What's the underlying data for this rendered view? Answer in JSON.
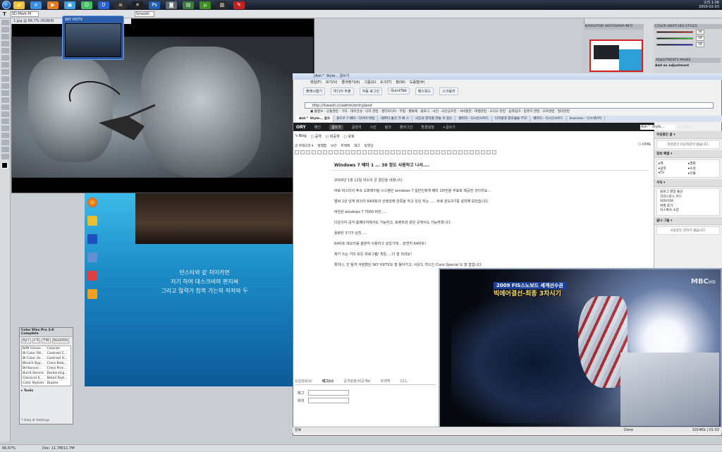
{
  "taskbar": {
    "clock_time": "오전 1:06",
    "clock_date": "2009-02-03",
    "buttons": [
      {
        "name": "explorer",
        "color": "#f0c040",
        "glyph": "📁"
      },
      {
        "name": "ie",
        "color": "#3a8de0",
        "glyph": "e"
      },
      {
        "name": "media",
        "color": "#e87a20",
        "glyph": "▶"
      },
      {
        "name": "paint",
        "color": "#40a0e0",
        "glyph": "▣"
      },
      {
        "name": "messenger",
        "color": "#40c060",
        "glyph": "☺"
      },
      {
        "name": "player",
        "color": "#2a60d0",
        "glyph": "D"
      },
      {
        "name": "skull",
        "color": "#303030",
        "glyph": "☠"
      },
      {
        "name": "xtool",
        "color": "#202020",
        "glyph": "✕"
      },
      {
        "name": "photoshop",
        "color": "#1e5fb0",
        "glyph": "Ps"
      },
      {
        "name": "camera",
        "color": "#606870",
        "glyph": "◙"
      },
      {
        "name": "film",
        "color": "#3c7a3c",
        "glyph": "▤"
      },
      {
        "name": "torrent",
        "color": "#3c8c20",
        "glyph": "µ"
      },
      {
        "name": "tv",
        "color": "#2a2a2a",
        "glyph": "▥"
      },
      {
        "name": "feather",
        "color": "#c82020",
        "glyph": "✎"
      }
    ]
  },
  "photoshop": {
    "tool_label": "T",
    "font_field": "SD-Mark-M",
    "size_field": "Smooth",
    "doc_title": "1.jpg @ 66.7% (RGB/8)",
    "nav_tabs": "NAVIGATOR  HISTOGRAM  INFO",
    "color_tabs": "COLOR  SWATCHES  STYLES",
    "color_values": [
      "34",
      "34",
      "34"
    ],
    "adjustments_tab": "ADJUSTMENTS  MASKS",
    "adjustments_hint": "Add an adjustment",
    "zoom": "66.67%",
    "doc_size": "Doc: 11.7M/11.7M"
  },
  "tv_mini": {
    "title": "SKY HDTV"
  },
  "desktop": {
    "text": [
      "빈스타와 같 처이카면",
      "저기 하여 대스크바의 편지써",
      "그리고 많력가 참복 가는의 직적와 두"
    ]
  },
  "efex": {
    "title": "Color Efex Pro 3.0 Complete",
    "tabs": [
      "Dy+",
      "L-S",
      "T-W",
      "Favorites"
    ],
    "filters": [
      "B/W Conve...",
      "Colorize",
      "Bi-Color Filt...",
      "Contrast C...",
      "Bi-Color Us...",
      "Contrast O...",
      "Bleach Byp...",
      "Cross Bala...",
      "Brilliance/...",
      "Cross Proc...",
      "Burnt Sienna",
      "Darken/Lig...",
      "Classical S...",
      "Detail Styli...",
      "Color Stylizer",
      "Duplex"
    ],
    "tools_label": "Tools",
    "footer": "? Help  ⚙ Settings"
  },
  "browser": {
    "title": "[Ash™ Style... 글쓰기",
    "menu": [
      "파일(F)",
      "보기(V)",
      "즐겨찾기(A)",
      "그룹(G)",
      "도구(T)",
      "창(W)",
      "도움말(H)"
    ],
    "tools": [
      "플래시벌기",
      "미디어 추출",
      "자동 로그인",
      "QuickTab",
      "패스워드",
      "스크롤러"
    ],
    "address": "http://liveash.cc/admin/entry/post",
    "links": "▣ 통합보 · 공통관련 · 기타 · 대우건설 · 디카 관련 · 멀티미디어 · 무협 · 벨류에 · 블로그 · 사진 · 사진공모전 · 서비헐힌 · 여행관련 · 오디오 관련 · 음악링크 · 컴퓨터 관련 · 호북관련 · 필라관련",
    "tabs": [
      {
        "label": "Ash™ Style... 글쓰",
        "active": true
      },
      {
        "label": "윈도우 7 베타 - 다이아 바탕",
        "active": false
      },
      {
        "label": "대파티 물건 가 예 스",
        "active": false
      },
      {
        "label": "사진의 엔지를 만들 수 있는",
        "active": false
      },
      {
        "label": "갤러리 - 디시인사이드",
        "active": false
      },
      {
        "label": "디지털과 창조물을 부모",
        "active": false
      },
      {
        "label": "갤러리 - 디시인사이드",
        "active": false
      },
      {
        "label": "Inaccess - 디시네이치",
        "active": false
      }
    ],
    "status_left": "완료",
    "status_done": "Done",
    "status_right": "1014Kb | 01:02"
  },
  "blog": {
    "logo": "ORY",
    "nav": [
      "메인",
      "글쓰기",
      "글관리",
      "스킨",
      "링크",
      "플러그인",
      "환경설정",
      "+글쓰기"
    ],
    "selected": "글쓰기",
    "search_placeholder": "Ash™ Style...",
    "login": "로그아웃",
    "blog_select": "'s Blog",
    "visibility": [
      "공개",
      "비공개",
      "보호"
    ],
    "options": [
      "글 카테고리 ▾",
      "발행함",
      "보안",
      "트랙백",
      "태그",
      "동영상"
    ],
    "html_label": "HTML",
    "post_title": "Windows 7 베타 1 ... 30 정도 사용하고 나서....",
    "post_lines": [
      "2009년 1월 12일 마소의 큰 결단을 내렸니다.",
      "바로 비스타의 후속 오퍼레이팅 시스템인 windows 7 일반인에게 베타 1버전을 무료로 제공한 것이지요...",
      "벌써 1년 넘게 비스타 64비트의 안정성에 만족을 하고 있던 저는 ..... 바로 윈도우7를 설치해 보았습니다.",
      "버전은 windows 7 7000 버전.....",
      "다운이야 공식 홈페이지에서도 가능하고, 토렌트와 같은 곳에서도 가능하였니다.",
      "용량은 3기가 남짓.....",
      "64비트 에오러를 충분히 사용하고 싶었기에....당연히 64비트!",
      "제가 쓰는 거의 모든 프로그램/ 게임.....다 잘 되네요!",
      "특히나, 안 될까 걱정했던 SKY HDTV도 잘 돌아가고, 사운드 카드인 Claro Special 도 잘 잡힙니다."
    ],
    "bottom_tabs": [
      "요일정보(▾)",
      "태그(▾)",
      "공개설정(비공개▾)",
      "트랙백",
      "CCL"
    ],
    "field_labels": [
      "태그",
      "위치"
    ]
  },
  "sidebar": {
    "sections": [
      {
        "title": "작성중인 글 ▾",
        "text": "작성중인 비공개글이 없습니다."
      },
      {
        "title": "정보 패널 ▾",
        "grid": [
          "책",
          "영화",
          "음악",
          "소설",
          "TV",
          "인물"
        ],
        "grid_prefix": "▸"
      },
      {
        "title": "서식 ▾",
        "list": [
          "블로그 맨일 플산",
          "크리스마스 카드",
          "100/10A",
          "여행 후기",
          "미스톡의 소장"
        ]
      },
      {
        "title": "글나 그림 ▾",
        "text": "사용중인 글자가 없습니다."
      }
    ]
  },
  "tv": {
    "caption1": "2009 FIS스노보드 세계선수권",
    "caption2": "빅에어결선-최종 3차시기",
    "logo": "MBC",
    "logo_suffix": "HD"
  }
}
